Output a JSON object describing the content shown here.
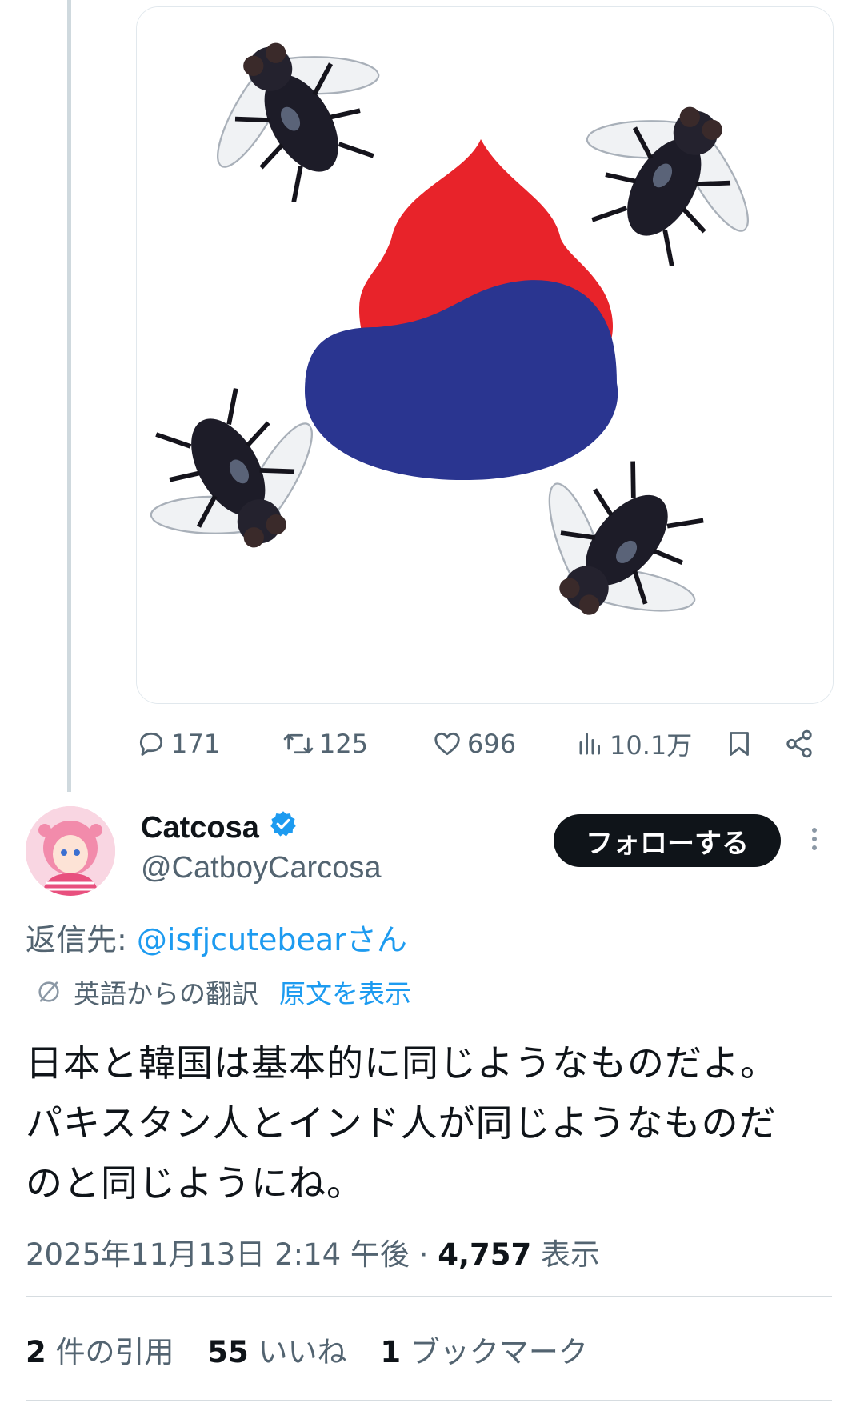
{
  "tweet_actions": {
    "replies": "171",
    "retweets": "125",
    "likes": "696",
    "views": "10.1万"
  },
  "author": {
    "name": "Catcosa",
    "handle": "@CatboyCarcosa",
    "verified_color": "#1d9bf0"
  },
  "follow_label": "フォローする",
  "reply_to": {
    "prefix": "返信先: ",
    "mention": "@isfjcutebearさん"
  },
  "translation": {
    "label": "英語からの翻訳",
    "show_original": "原文を表示"
  },
  "tweet_text": [
    "日本と韓国は基本的に同じようなものだよ。",
    "パキスタン人とインド人が同じようなものだ",
    "のと同じようにね。"
  ],
  "meta": {
    "timestamp": "2025年11月13日 2:14 午後",
    "separator": " · ",
    "views_count": "4,757",
    "views_label": " 表示"
  },
  "engagement": {
    "quotes_count": "2",
    "quotes_label": " 件の引用",
    "likes_count": "55",
    "likes_label": " いいね",
    "bookmarks_count": "1",
    "bookmarks_label": " ブックマーク"
  },
  "colors": {
    "accent": "#1d9bf0",
    "text_secondary": "#536471",
    "image_red": "#e8232a",
    "image_blue": "#2a3590"
  }
}
